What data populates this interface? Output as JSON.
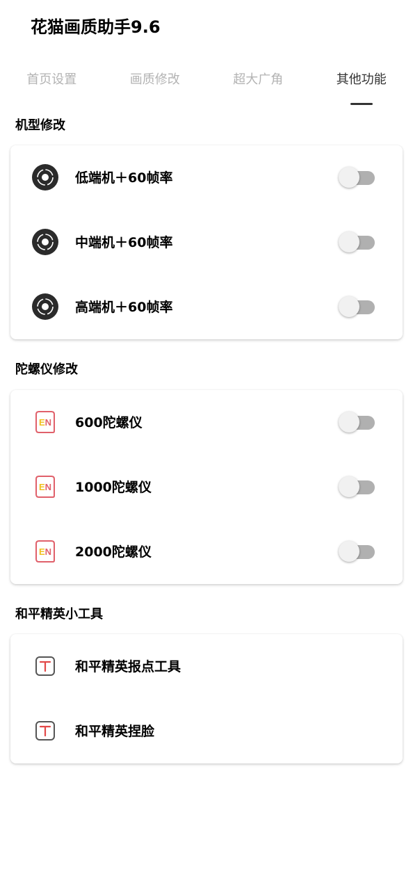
{
  "app": {
    "title": "花猫画质助手9.6"
  },
  "tabs": [
    {
      "label": "首页设置",
      "active": false
    },
    {
      "label": "画质修改",
      "active": false
    },
    {
      "label": "超大广角",
      "active": false
    },
    {
      "label": "其他功能",
      "active": true
    }
  ],
  "sections": [
    {
      "title": "机型修改",
      "items": [
        {
          "label": "低端机＋60帧率",
          "icon": "circle-target-icon",
          "toggle": false
        },
        {
          "label": "中端机＋60帧率",
          "icon": "circle-target-icon",
          "toggle": false
        },
        {
          "label": "高端机＋60帧率",
          "icon": "circle-target-icon",
          "toggle": false
        }
      ]
    },
    {
      "title": "陀螺仪修改",
      "items": [
        {
          "label": "600陀螺仪",
          "icon": "en-badge-icon",
          "icon_text": "EN",
          "toggle": false
        },
        {
          "label": "1000陀螺仪",
          "icon": "en-badge-icon",
          "icon_text": "EN",
          "toggle": false
        },
        {
          "label": "2000陀螺仪",
          "icon": "en-badge-icon",
          "icon_text": "EN",
          "toggle": false
        }
      ]
    },
    {
      "title": "和平精英小工具",
      "items": [
        {
          "label": "和平精英报点工具",
          "icon": "t-box-icon"
        },
        {
          "label": "和平精英捏脸",
          "icon": "t-box-icon"
        }
      ]
    }
  ],
  "colors": {
    "tab_inactive": "#b3b3b3",
    "tab_active": "#333333",
    "toggle_track_off": "#b0b0b0",
    "toggle_thumb_off": "#f1f1f1",
    "icon_dark": "#2b2b2b",
    "en_border": "#e0606a",
    "en_letter_e": "#f0c020",
    "en_letter_n": "#e0606a",
    "t_icon_red": "#e24848",
    "t_icon_border": "#555555"
  }
}
